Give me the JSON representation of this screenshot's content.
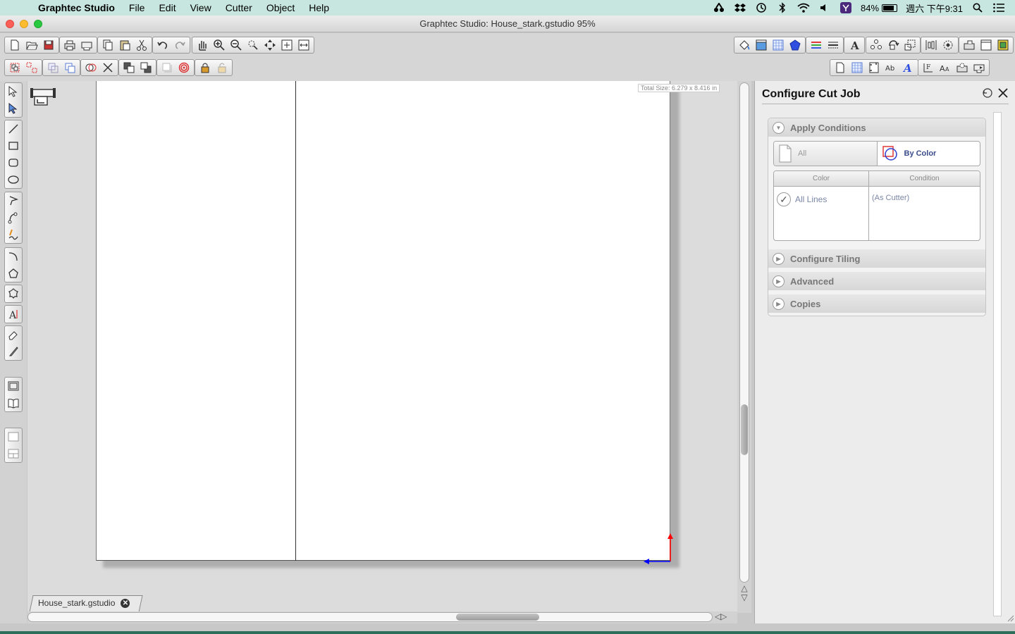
{
  "menubar": {
    "app_name": "Graphtec Studio",
    "items": [
      "File",
      "Edit",
      "View",
      "Cutter",
      "Object",
      "Help"
    ],
    "battery_percent": "84%",
    "battery_level": 0.84,
    "clock": "週六 下午9:31"
  },
  "window": {
    "title": "Graphtec Studio: House_stark.gstudio 95%"
  },
  "canvas": {
    "total_size": "Total Size: 6.279 x 8.416 in"
  },
  "document_tab": {
    "label": "House_stark.gstudio",
    "close_glyph": "✕"
  },
  "panel": {
    "title": "Configure Cut Job",
    "sections": {
      "apply_conditions": "Apply Conditions",
      "configure_tiling": "Configure Tiling",
      "advanced": "Advanced",
      "copies": "Copies"
    },
    "segments": {
      "all": "All",
      "by_color": "By Color"
    },
    "table": {
      "headers": {
        "color": "Color",
        "condition": "Condition"
      },
      "rows": [
        {
          "color": "All Lines",
          "condition": "(As Cutter)"
        }
      ]
    }
  },
  "colors": {
    "menubar_bg": "#c8e6e0",
    "origin_x_axis": "#0000ff",
    "origin_y_axis": "#ff0000",
    "by_color_accent": "#3a4c8a"
  }
}
